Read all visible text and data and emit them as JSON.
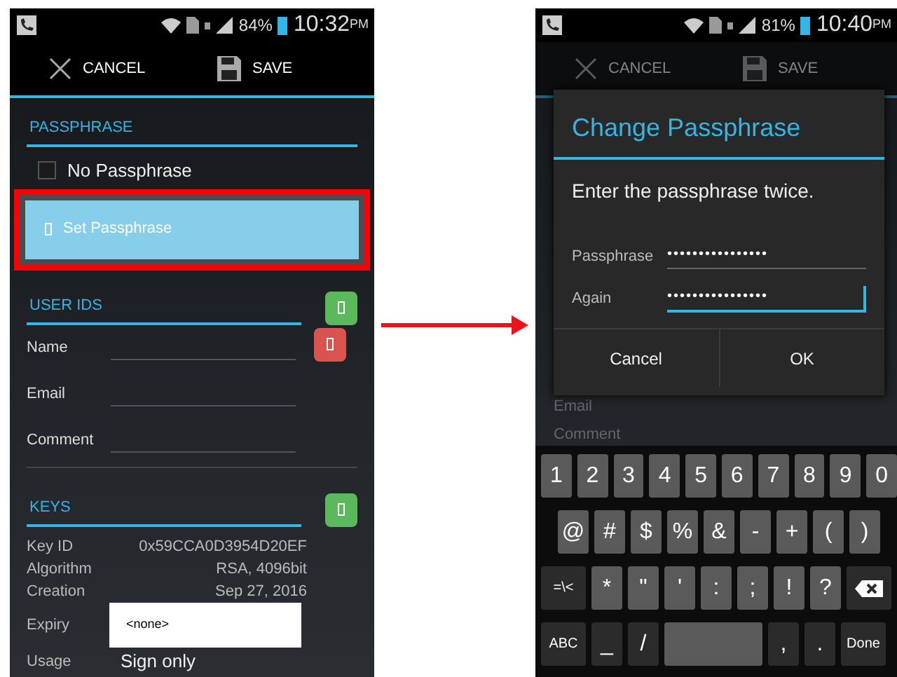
{
  "left_screen": {
    "status_bar": {
      "battery": "84%",
      "time": "10:32",
      "ampm": "PM"
    },
    "action_bar": {
      "cancel": "CANCEL",
      "save": "SAVE",
      "dimmed": false
    },
    "passphrase_section": {
      "title": "PASSPHRASE",
      "no_passphrase": {
        "label": "No Passphrase",
        "checked": false
      },
      "set_button": "Set Passphrase",
      "highlighted": true
    },
    "user_ids": {
      "title": "USER IDS",
      "fields": [
        {
          "label": "Name",
          "removable": true
        },
        {
          "label": "Email",
          "removable": false
        },
        {
          "label": "Comment",
          "removable": false
        }
      ]
    },
    "keys": {
      "title": "KEYS",
      "rows": [
        {
          "label": "Key ID",
          "value": "0x59CCA0D3954D20EF"
        },
        {
          "label": "Algorithm",
          "value": "RSA, 4096bit"
        },
        {
          "label": "Creation",
          "value": "Sep 27, 2016"
        }
      ],
      "expiry": {
        "label": "Expiry",
        "value": "<none>"
      },
      "usage": {
        "label": "Usage",
        "value": "Sign only"
      }
    }
  },
  "right_screen": {
    "status_bar": {
      "battery": "81%",
      "time": "10:40",
      "ampm": "PM"
    },
    "action_bar": {
      "cancel": "CANCEL",
      "save": "SAVE",
      "dimmed": true
    },
    "background_fields": [
      {
        "label": "Email"
      },
      {
        "label": "Comment"
      }
    ],
    "dialog": {
      "title": "Change Passphrase",
      "message": "Enter the passphrase twice.",
      "fields": [
        {
          "label": "Passphrase",
          "value": "••••••••••••••••",
          "focused": false
        },
        {
          "label": "Again",
          "value": "••••••••••••••••",
          "focused": true
        }
      ],
      "buttons": [
        "Cancel",
        "OK"
      ]
    },
    "keyboard": {
      "rows": [
        [
          {
            "kind": "char",
            "label": "1"
          },
          {
            "kind": "char",
            "label": "2"
          },
          {
            "kind": "char",
            "label": "3"
          },
          {
            "kind": "char",
            "label": "4"
          },
          {
            "kind": "char",
            "label": "5"
          },
          {
            "kind": "char",
            "label": "6"
          },
          {
            "kind": "char",
            "label": "7"
          },
          {
            "kind": "char",
            "label": "8"
          },
          {
            "kind": "char",
            "label": "9"
          },
          {
            "kind": "char",
            "label": "0"
          }
        ],
        [
          {
            "kind": "char",
            "label": "@"
          },
          {
            "kind": "char",
            "label": "#"
          },
          {
            "kind": "char",
            "label": "$"
          },
          {
            "kind": "char",
            "label": "%"
          },
          {
            "kind": "char",
            "label": "&"
          },
          {
            "kind": "char",
            "label": "-"
          },
          {
            "kind": "char",
            "label": "+"
          },
          {
            "kind": "char",
            "label": "("
          },
          {
            "kind": "char",
            "label": ")"
          }
        ],
        [
          {
            "kind": "function",
            "label": "=\\<"
          },
          {
            "kind": "char",
            "label": "*"
          },
          {
            "kind": "char",
            "label": "\""
          },
          {
            "kind": "char",
            "label": "'"
          },
          {
            "kind": "char",
            "label": ":"
          },
          {
            "kind": "char",
            "label": ";"
          },
          {
            "kind": "char",
            "label": "!"
          },
          {
            "kind": "char",
            "label": "?"
          },
          {
            "kind": "backspace"
          }
        ],
        [
          {
            "kind": "function",
            "label": "ABC"
          },
          {
            "kind": "dark",
            "label": "_"
          },
          {
            "kind": "dark",
            "label": "/"
          },
          {
            "kind": "space"
          },
          {
            "kind": "dark",
            "label": ","
          },
          {
            "kind": "dark",
            "label": "."
          },
          {
            "kind": "function",
            "label": "Done"
          }
        ]
      ]
    }
  }
}
